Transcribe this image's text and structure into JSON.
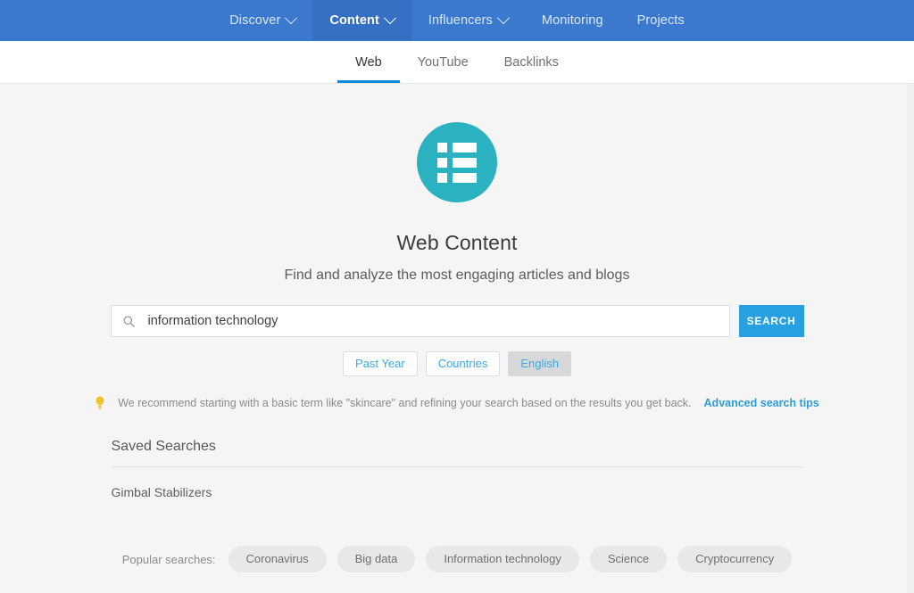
{
  "colors": {
    "nav_blue": "#3b79ce",
    "nav_active_blue": "#3570c4",
    "accent_blue": "#26a0e0",
    "tab_underline": "#0f8bd7",
    "hero_teal": "#2bb2c0",
    "page_bg": "#f5f5f5",
    "chip_selected_bg": "#d7d8da",
    "bulb_yellow": "#f2c229"
  },
  "topnav": {
    "items": [
      {
        "label": "Discover",
        "has_caret": true,
        "active": false
      },
      {
        "label": "Content",
        "has_caret": true,
        "active": true
      },
      {
        "label": "Influencers",
        "has_caret": true,
        "active": false
      },
      {
        "label": "Monitoring",
        "has_caret": false,
        "active": false
      },
      {
        "label": "Projects",
        "has_caret": false,
        "active": false
      }
    ]
  },
  "subnav": {
    "tabs": [
      {
        "label": "Web",
        "active": true
      },
      {
        "label": "YouTube",
        "active": false
      },
      {
        "label": "Backlinks",
        "active": false
      }
    ]
  },
  "hero": {
    "icon": "list-icon",
    "title": "Web Content",
    "subtitle": "Find and analyze the most engaging articles and blogs"
  },
  "search": {
    "icon": "search-icon",
    "value": "information technology",
    "placeholder": "",
    "button_label": "SEARCH"
  },
  "filters": [
    {
      "label": "Past Year",
      "selected": false
    },
    {
      "label": "Countries",
      "selected": false
    },
    {
      "label": "English",
      "selected": true
    }
  ],
  "tip": {
    "icon": "lightbulb-icon",
    "text": "We recommend starting with a basic term like \"skincare\" and refining your search based on the results you get back.",
    "link_label": "Advanced search tips"
  },
  "saved_searches": {
    "heading": "Saved Searches",
    "items": [
      {
        "label": "Gimbal Stabilizers"
      }
    ]
  },
  "popular_searches": {
    "label": "Popular searches:",
    "items": [
      {
        "label": "Coronavirus"
      },
      {
        "label": "Big data"
      },
      {
        "label": "Information technology"
      },
      {
        "label": "Science"
      },
      {
        "label": "Cryptocurrency"
      }
    ]
  }
}
